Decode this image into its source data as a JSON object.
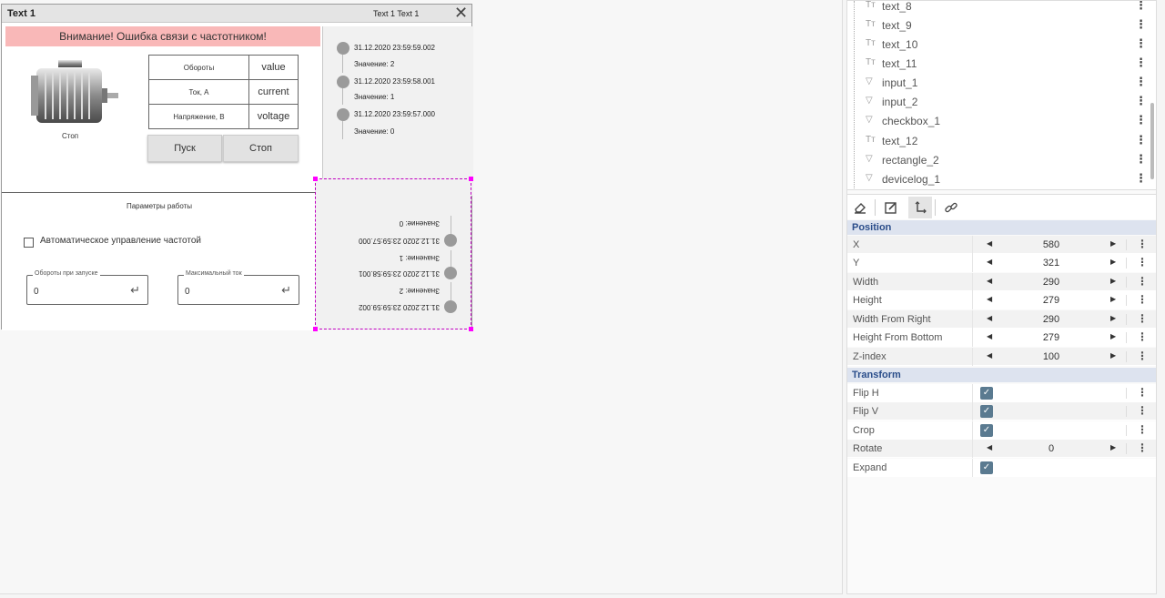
{
  "window": {
    "title": "Text 1",
    "subtitle": "Text 1  Text 1",
    "close": "✕"
  },
  "alarm": "Внимание! Ошибка связи с частотником!",
  "motor": {
    "label": "Стоп"
  },
  "params_table": [
    {
      "name": "Обороты",
      "value": "value"
    },
    {
      "name": "Ток, А",
      "value": "current"
    },
    {
      "name": "Напряжение, В",
      "value": "voltage"
    }
  ],
  "buttons": {
    "start": "Пуск",
    "stop": "Стоп"
  },
  "event_log": [
    {
      "time": "31.12.2020 23:59:59.002",
      "value": "Значение: 2"
    },
    {
      "time": "31.12.2020 23:59:58.001",
      "value": "Значение: 1"
    },
    {
      "time": "31.12.2020 23:59:57.000",
      "value": "Значение: 0"
    }
  ],
  "params_panel": {
    "title": "Параметры работы",
    "checkbox_label": "Автоматическое управление частотой",
    "field1": {
      "legend": "Обороты при запуске",
      "value": "0"
    },
    "field2": {
      "legend": "Максимальный ток",
      "value": "0"
    }
  },
  "tree": {
    "items": [
      {
        "icon": "Tт",
        "label": "text_8"
      },
      {
        "icon": "Tт",
        "label": "text_9"
      },
      {
        "icon": "Tт",
        "label": "text_10"
      },
      {
        "icon": "Tт",
        "label": "text_11"
      },
      {
        "icon": "▽",
        "label": "input_1"
      },
      {
        "icon": "▽",
        "label": "input_2"
      },
      {
        "icon": "▽",
        "label": "checkbox_1"
      },
      {
        "icon": "Tт",
        "label": "text_12"
      },
      {
        "icon": "▽",
        "label": "rectangle_2"
      },
      {
        "icon": "▽",
        "label": "devicelog_1"
      }
    ]
  },
  "toolbar": [
    "eraser-icon",
    "edit-icon",
    "move-icon",
    "link-icon"
  ],
  "properties": {
    "position_title": "Position",
    "position": [
      {
        "key": "X",
        "value": "580"
      },
      {
        "key": "Y",
        "value": "321"
      },
      {
        "key": "Width",
        "value": "290"
      },
      {
        "key": "Height",
        "value": "279"
      },
      {
        "key": "Width From Right",
        "value": "290"
      },
      {
        "key": "Height From Bottom",
        "value": "279"
      },
      {
        "key": "Z-index",
        "value": "100"
      }
    ],
    "transform_title": "Transform",
    "transform": [
      {
        "key": "Flip H",
        "checked": true
      },
      {
        "key": "Flip V",
        "checked": true
      },
      {
        "key": "Crop",
        "checked": true
      },
      {
        "key": "Rotate",
        "value": "0"
      },
      {
        "key": "Expand",
        "checked": true
      }
    ]
  },
  "colors": {
    "alarm": "#f9b8b8",
    "selection": "#ff00ff",
    "section": "#dde3ef",
    "checkbox": "#5a7a90"
  }
}
